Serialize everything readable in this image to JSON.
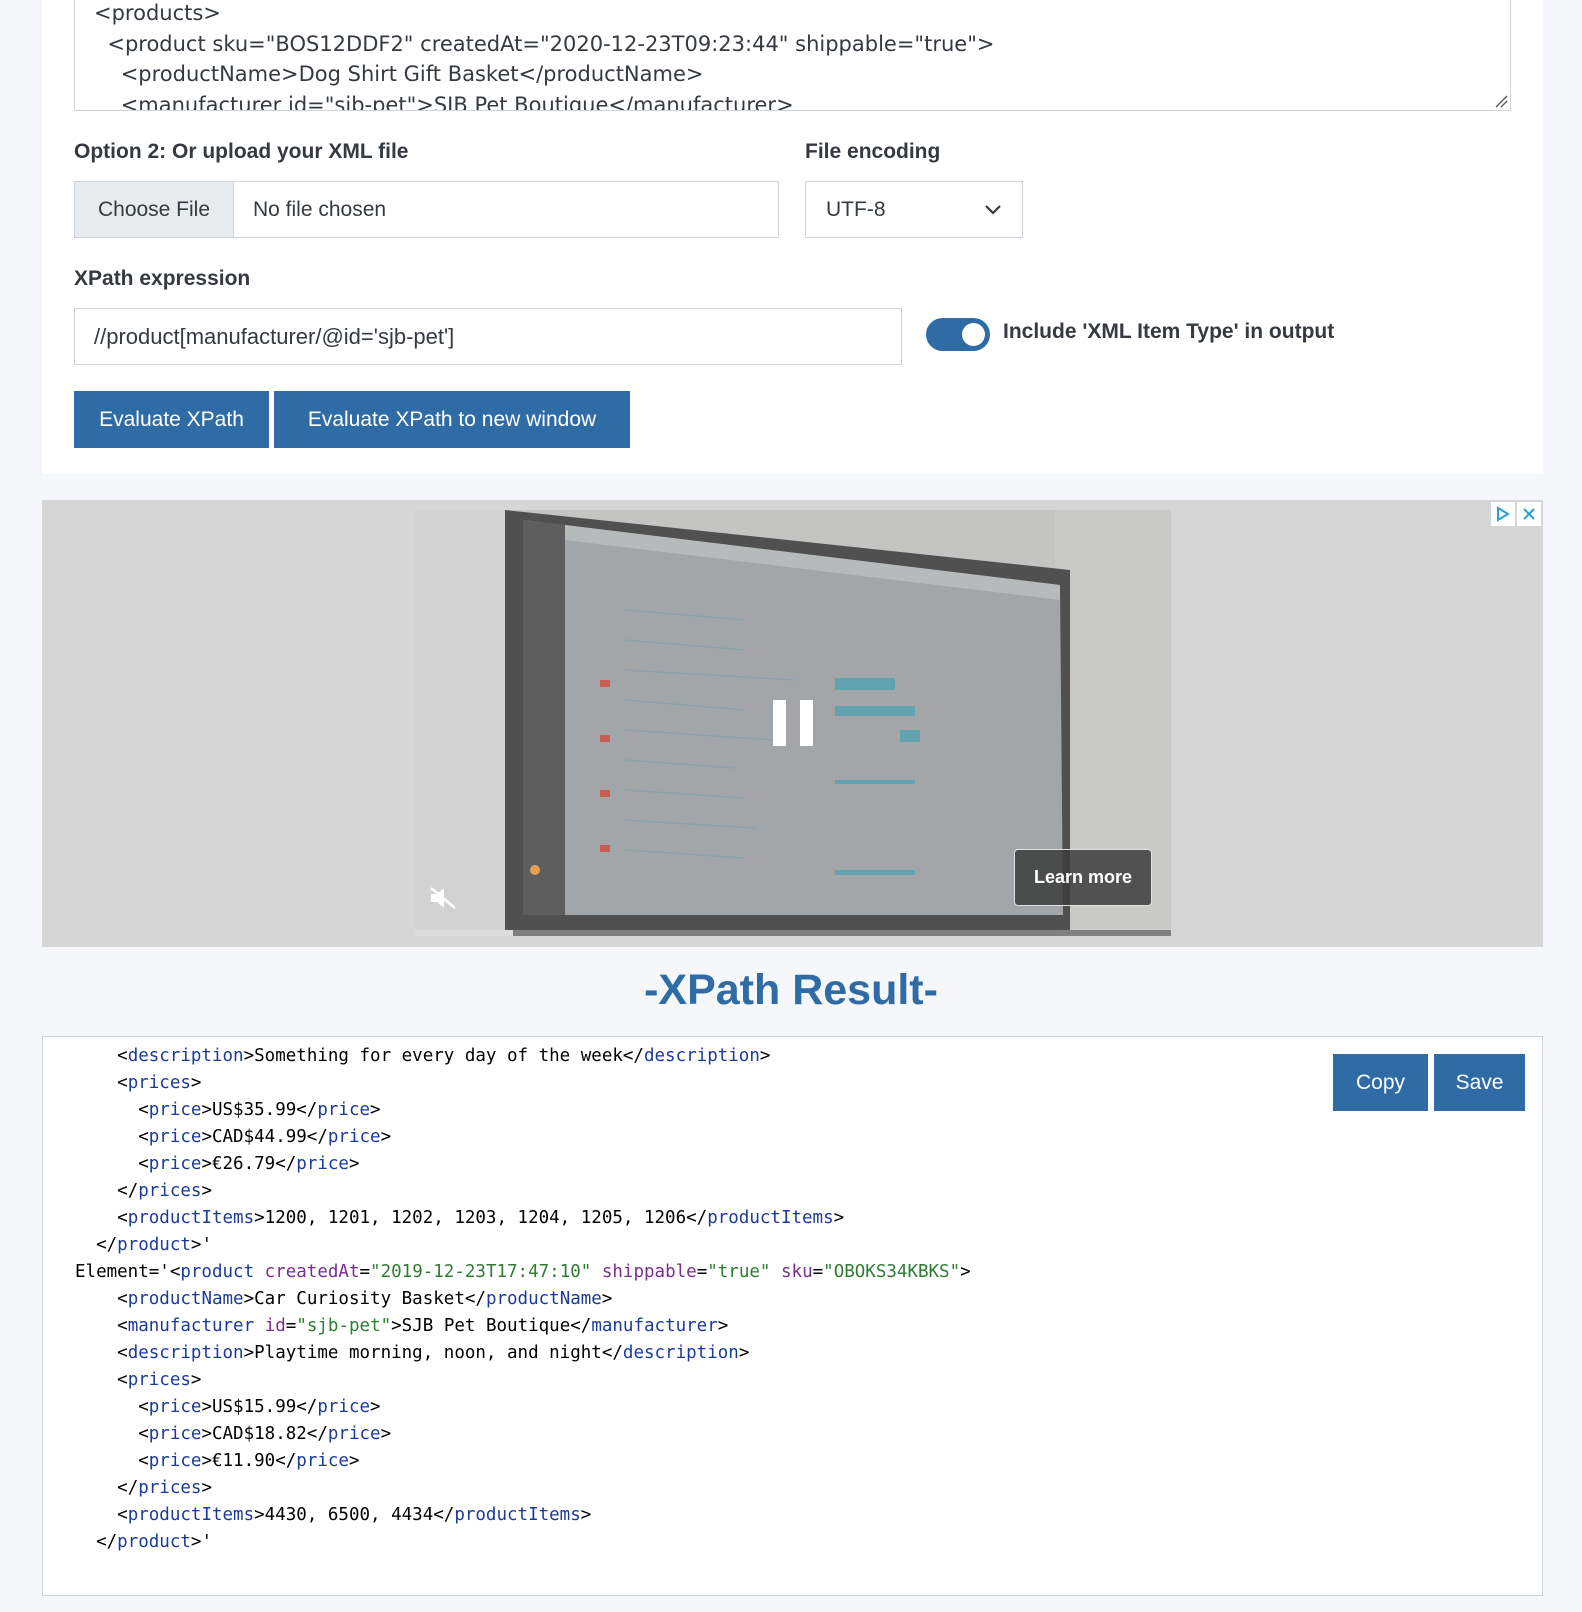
{
  "xml_input": {
    "lines": [
      "<products>",
      "  <product sku=\"BOS12DDF2\" createdAt=\"2020-12-23T09:23:44\" shippable=\"true\">",
      "    <productName>Dog Shirt Gift Basket</productName>",
      "    <manufacturer id=\"sjb-pet\">SJB Pet Boutique</manufacturer>"
    ]
  },
  "upload": {
    "label": "Option 2: Or upload your XML file",
    "choose_button": "Choose File",
    "file_name": "No file chosen"
  },
  "encoding": {
    "label": "File encoding",
    "value": "UTF-8"
  },
  "xpath": {
    "label": "XPath expression",
    "value": "//product[manufacturer/@id='sjb-pet']",
    "include_item_type_label": "Include 'XML Item Type' in output",
    "include_item_type_on": true
  },
  "buttons": {
    "evaluate": "Evaluate XPath",
    "evaluate_new_window": "Evaluate XPath to new window",
    "copy": "Copy",
    "save": "Save"
  },
  "ad": {
    "learn_more": "Learn more",
    "progress_fraction": 0.13
  },
  "result": {
    "title": "-XPath Result-",
    "lines": [
      [
        [
          "t",
          "    "
        ],
        [
          "p",
          "<"
        ],
        [
          "g",
          "description"
        ],
        [
          "p",
          ">Something for every day of the week</"
        ],
        [
          "g",
          "description"
        ],
        [
          "p",
          ">"
        ]
      ],
      [
        [
          "t",
          "    "
        ],
        [
          "p",
          "<"
        ],
        [
          "g",
          "prices"
        ],
        [
          "p",
          ">"
        ]
      ],
      [
        [
          "t",
          "      "
        ],
        [
          "p",
          "<"
        ],
        [
          "g",
          "price"
        ],
        [
          "p",
          ">US$35.99</"
        ],
        [
          "g",
          "price"
        ],
        [
          "p",
          ">"
        ]
      ],
      [
        [
          "t",
          "      "
        ],
        [
          "p",
          "<"
        ],
        [
          "g",
          "price"
        ],
        [
          "p",
          ">CAD$44.99</"
        ],
        [
          "g",
          "price"
        ],
        [
          "p",
          ">"
        ]
      ],
      [
        [
          "t",
          "      "
        ],
        [
          "p",
          "<"
        ],
        [
          "g",
          "price"
        ],
        [
          "p",
          ">€26.79</"
        ],
        [
          "g",
          "price"
        ],
        [
          "p",
          ">"
        ]
      ],
      [
        [
          "t",
          "    "
        ],
        [
          "p",
          "</"
        ],
        [
          "g",
          "prices"
        ],
        [
          "p",
          ">"
        ]
      ],
      [
        [
          "t",
          "    "
        ],
        [
          "p",
          "<"
        ],
        [
          "g",
          "productItems"
        ],
        [
          "p",
          ">1200, 1201, 1202, 1203, 1204, 1205, 1206</"
        ],
        [
          "g",
          "productItems"
        ],
        [
          "p",
          ">"
        ]
      ],
      [
        [
          "t",
          "  "
        ],
        [
          "p",
          "</"
        ],
        [
          "g",
          "product"
        ],
        [
          "p",
          ">'"
        ]
      ],
      [
        [
          "p",
          "Element='<"
        ],
        [
          "g",
          "product"
        ],
        [
          "p",
          " "
        ],
        [
          "a",
          "createdAt"
        ],
        [
          "p",
          "="
        ],
        [
          "v",
          "\"2019-12-23T17:47:10\""
        ],
        [
          "p",
          " "
        ],
        [
          "a",
          "shippable"
        ],
        [
          "p",
          "="
        ],
        [
          "v",
          "\"true\""
        ],
        [
          "p",
          " "
        ],
        [
          "a",
          "sku"
        ],
        [
          "p",
          "="
        ],
        [
          "v",
          "\"OBOKS34KBKS\""
        ],
        [
          "p",
          ">"
        ]
      ],
      [
        [
          "t",
          "    "
        ],
        [
          "p",
          "<"
        ],
        [
          "g",
          "productName"
        ],
        [
          "p",
          ">Car Curiosity Basket</"
        ],
        [
          "g",
          "productName"
        ],
        [
          "p",
          ">"
        ]
      ],
      [
        [
          "t",
          "    "
        ],
        [
          "p",
          "<"
        ],
        [
          "g",
          "manufacturer"
        ],
        [
          "p",
          " "
        ],
        [
          "a",
          "id"
        ],
        [
          "p",
          "="
        ],
        [
          "v",
          "\"sjb-pet\""
        ],
        [
          "p",
          ">SJB Pet Boutique</"
        ],
        [
          "g",
          "manufacturer"
        ],
        [
          "p",
          ">"
        ]
      ],
      [
        [
          "t",
          "    "
        ],
        [
          "p",
          "<"
        ],
        [
          "g",
          "description"
        ],
        [
          "p",
          ">Playtime morning, noon, and night</"
        ],
        [
          "g",
          "description"
        ],
        [
          "p",
          ">"
        ]
      ],
      [
        [
          "t",
          "    "
        ],
        [
          "p",
          "<"
        ],
        [
          "g",
          "prices"
        ],
        [
          "p",
          ">"
        ]
      ],
      [
        [
          "t",
          "      "
        ],
        [
          "p",
          "<"
        ],
        [
          "g",
          "price"
        ],
        [
          "p",
          ">US$15.99</"
        ],
        [
          "g",
          "price"
        ],
        [
          "p",
          ">"
        ]
      ],
      [
        [
          "t",
          "      "
        ],
        [
          "p",
          "<"
        ],
        [
          "g",
          "price"
        ],
        [
          "p",
          ">CAD$18.82</"
        ],
        [
          "g",
          "price"
        ],
        [
          "p",
          ">"
        ]
      ],
      [
        [
          "t",
          "      "
        ],
        [
          "p",
          "<"
        ],
        [
          "g",
          "price"
        ],
        [
          "p",
          ">€11.90</"
        ],
        [
          "g",
          "price"
        ],
        [
          "p",
          ">"
        ]
      ],
      [
        [
          "t",
          "    "
        ],
        [
          "p",
          "</"
        ],
        [
          "g",
          "prices"
        ],
        [
          "p",
          ">"
        ]
      ],
      [
        [
          "t",
          "    "
        ],
        [
          "p",
          "<"
        ],
        [
          "g",
          "productItems"
        ],
        [
          "p",
          ">4430, 6500, 4434</"
        ],
        [
          "g",
          "productItems"
        ],
        [
          "p",
          ">"
        ]
      ],
      [
        [
          "t",
          "  "
        ],
        [
          "p",
          "</"
        ],
        [
          "g",
          "product"
        ],
        [
          "p",
          ">'"
        ]
      ]
    ]
  },
  "colors": {
    "accent": "#2f6ba5",
    "xml_tag": "#1b3a9a",
    "xml_attr": "#7b2c8f",
    "xml_value": "#2e7d32"
  }
}
